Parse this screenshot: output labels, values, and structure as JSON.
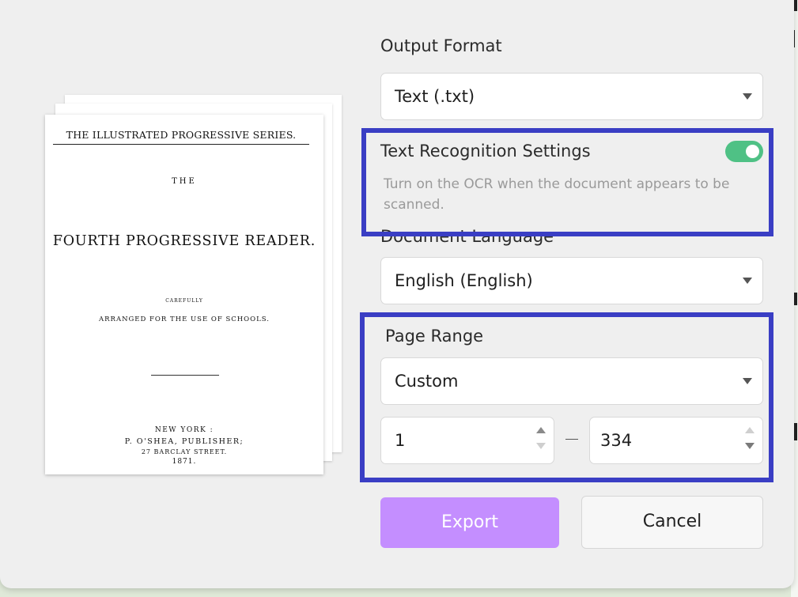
{
  "preview": {
    "series": "THE ILLUSTRATED PROGRESSIVE SERIES.",
    "the": "THE",
    "title": "FOURTH PROGRESSIVE READER.",
    "carefully": "CAREFULLY",
    "arranged": "ARRANGED FOR THE USE OF SCHOOLS.",
    "city": "NEW YORK :",
    "publisher": "P. O'SHEA, PUBLISHER;",
    "street": "27 BARCLAY STREET.",
    "year": "1871."
  },
  "output_format": {
    "label": "Output Format",
    "value": "Text (.txt)"
  },
  "ocr": {
    "title": "Text Recognition Settings",
    "description": "Turn on the OCR when the document appears to be scanned.",
    "enabled": true
  },
  "document_language": {
    "label": "Document Language",
    "value": "English (English)"
  },
  "page_range": {
    "label": "Page Range",
    "mode": "Custom",
    "from": "1",
    "to": "334"
  },
  "buttons": {
    "export": "Export",
    "cancel": "Cancel"
  },
  "colors": {
    "highlight": "#3a3ec4",
    "toggle_on": "#4fc185",
    "export_button": "#c48eff"
  }
}
